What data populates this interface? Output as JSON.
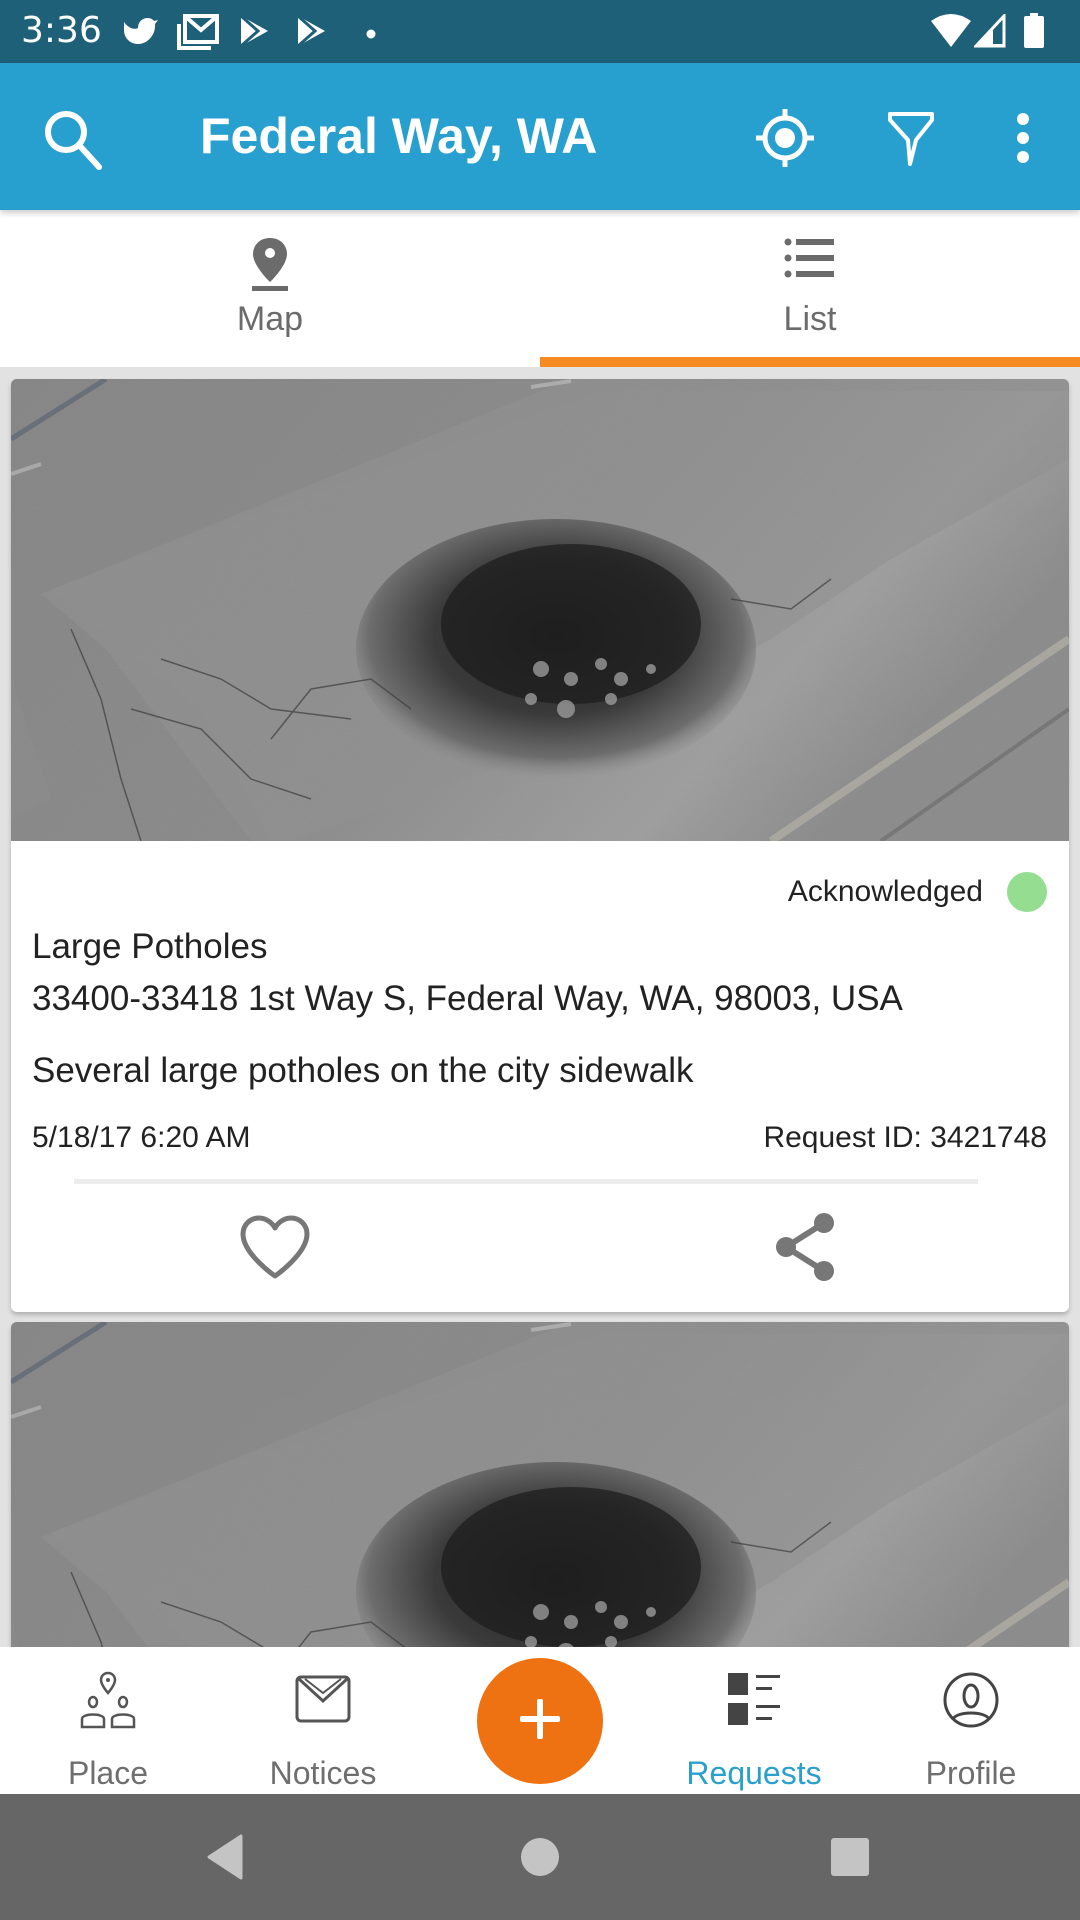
{
  "status_bar": {
    "time": "3:36",
    "notification_icons": [
      "bird-app-icon",
      "gmail-icon",
      "play-store-icon",
      "play-store-icon",
      "more-notifications-dot-icon"
    ],
    "system_icons": [
      "wifi-icon",
      "cell-signal-icon",
      "battery-icon"
    ]
  },
  "app_bar": {
    "title": "Federal Way, WA",
    "left_icon": "search-icon",
    "right_icons": [
      "my-location-icon",
      "filter-icon",
      "overflow-menu-icon"
    ]
  },
  "tabs": [
    {
      "label": "Map",
      "icon": "map-pin-icon",
      "active": false
    },
    {
      "label": "List",
      "icon": "list-icon",
      "active": true
    }
  ],
  "colors": {
    "status_bar": "#1e6078",
    "app_bar": "#27a0cf",
    "tab_indicator": "#f78a20",
    "fab": "#ee7112",
    "active_nav": "#2aa0cc",
    "status_acknowledged": "#95dd91",
    "system_nav": "#666666"
  },
  "requests": [
    {
      "image_alt": "Pothole in asphalt pavement",
      "status": "Acknowledged",
      "title": "Large Potholes",
      "address": "33400-33418 1st Way S, Federal Way, WA, 98003, USA",
      "description": "Several large potholes on the city sidewalk",
      "date": "5/18/17 6:20 AM",
      "request_id": "Request ID: 3421748",
      "actions": [
        "like-heart-icon",
        "share-icon"
      ]
    },
    {
      "image_alt": "Pothole in asphalt pavement"
    }
  ],
  "bottom_nav": {
    "items": [
      {
        "label": "Place",
        "icon": "place-icon",
        "active": false
      },
      {
        "label": "Notices",
        "icon": "notices-envelope-icon",
        "active": false
      },
      {
        "label": "Requests",
        "icon": "requests-icon",
        "active": true
      },
      {
        "label": "Profile",
        "icon": "profile-icon",
        "active": false
      }
    ],
    "fab_icon": "add-icon"
  },
  "system_nav": [
    "back-icon",
    "home-icon",
    "recents-icon"
  ]
}
